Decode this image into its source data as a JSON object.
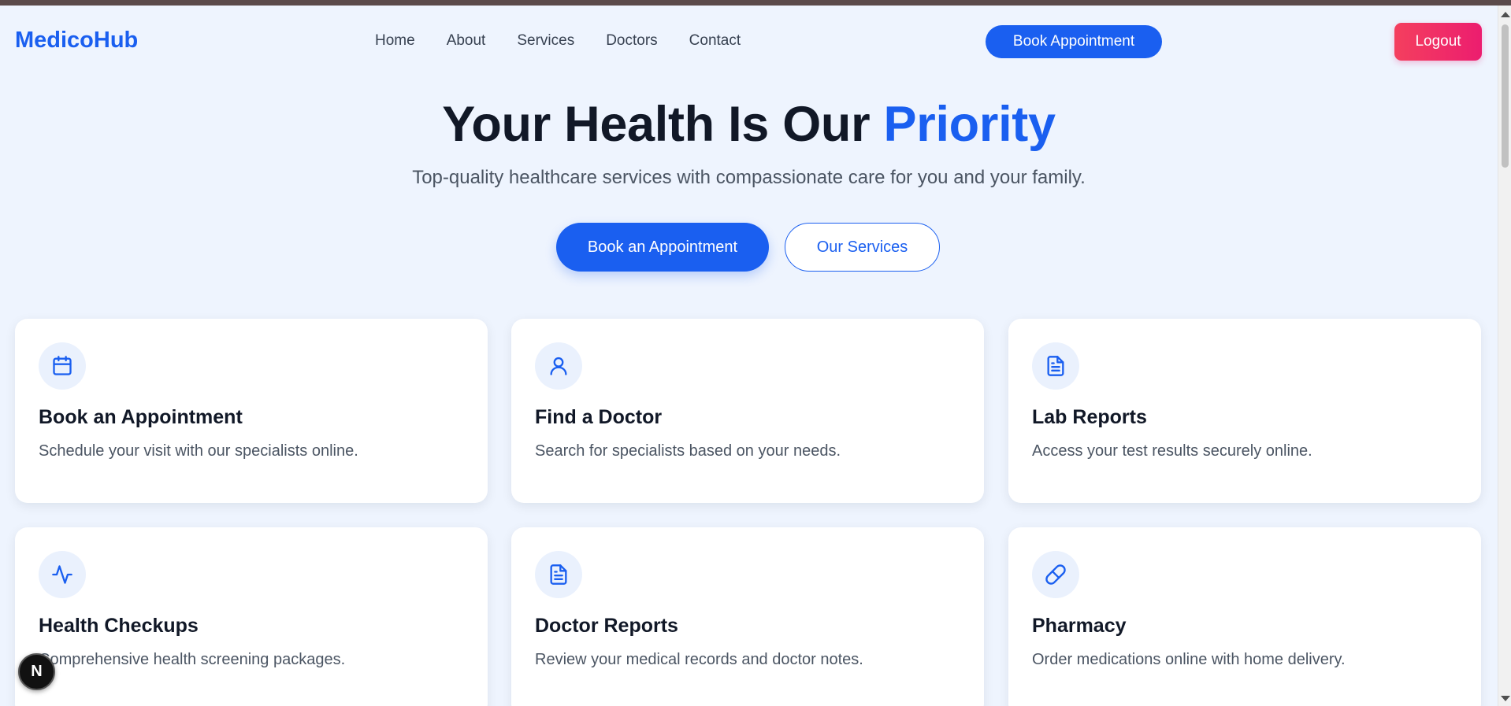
{
  "brand": "MedicoHub",
  "nav": {
    "links": [
      "Home",
      "About",
      "Services",
      "Doctors",
      "Contact"
    ],
    "book_label": "Book Appointment",
    "logout_label": "Logout"
  },
  "hero": {
    "title_main": "Your Health Is Our ",
    "title_accent": "Priority",
    "subtitle": "Top-quality healthcare services with compassionate care for you and your family.",
    "primary_cta": "Book an Appointment",
    "secondary_cta": "Our Services"
  },
  "services": [
    {
      "icon": "calendar-icon",
      "title": "Book an Appointment",
      "description": "Schedule your visit with our specialists online."
    },
    {
      "icon": "user-icon",
      "title": "Find a Doctor",
      "description": "Search for specialists based on your needs."
    },
    {
      "icon": "document-icon",
      "title": "Lab Reports",
      "description": "Access your test results securely online."
    },
    {
      "icon": "activity-icon",
      "title": "Health Checkups",
      "description": "Comprehensive health screening packages."
    },
    {
      "icon": "document-icon",
      "title": "Doctor Reports",
      "description": "Review your medical records and doctor notes."
    },
    {
      "icon": "pill-icon",
      "title": "Pharmacy",
      "description": "Order medications online with home delivery."
    }
  ],
  "dev_badge": "N",
  "colors": {
    "primary": "#1a5ff0",
    "background": "#eef4fe",
    "logout": "#f43f5e"
  }
}
